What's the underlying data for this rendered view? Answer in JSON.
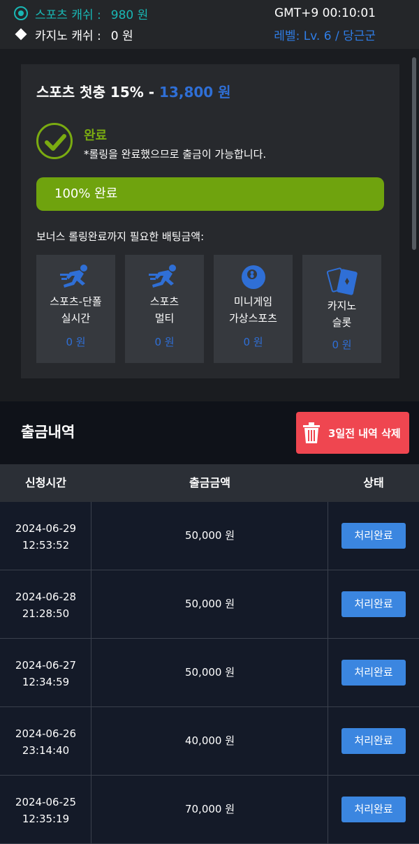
{
  "topbar": {
    "sports_cash_label": "스포츠 캐쉬 :",
    "sports_cash_value": "980 원",
    "casino_cash_label": "카지노 캐쉬 :",
    "casino_cash_value": "0 원",
    "clock": "GMT+9 00:10:01",
    "level": "레벨: Lv. 6 / 당근군"
  },
  "bonus_card": {
    "title": "스포츠 첫충 15% -",
    "amount": "13,800 원",
    "done_label": "완료",
    "done_note": "*롤링을 완료했으므로 출금이 가능합니다.",
    "progress_percent": 100,
    "progress_label": "100% 완료",
    "required_label": "보너스 롤링완료까지 필요한 배팅금액:",
    "tiles": [
      {
        "icon": "runner-icon",
        "line1": "스포츠-단폴",
        "line2": "실시간",
        "value": "0 원"
      },
      {
        "icon": "runner-icon",
        "line1": "스포츠",
        "line2": "멀티",
        "value": "0 원"
      },
      {
        "icon": "ball-8-icon",
        "line1": "미니게임",
        "line2": "가상스포츠",
        "value": "0 원"
      },
      {
        "icon": "cards-icon",
        "line1": "카지노",
        "line2": "슬롯",
        "value": "0 원"
      }
    ]
  },
  "withdrawals": {
    "title": "출금내역",
    "delete_button": "3일전 내역 삭제",
    "columns": [
      "신청시간",
      "출금금액",
      "상태"
    ],
    "rows": [
      {
        "date": "2024-06-29",
        "time": "12:53:52",
        "amount": "50,000 원",
        "status": "처리완료"
      },
      {
        "date": "2024-06-28",
        "time": "21:28:50",
        "amount": "50,000 원",
        "status": "처리완료"
      },
      {
        "date": "2024-06-27",
        "time": "12:34:59",
        "amount": "50,000 원",
        "status": "처리완료"
      },
      {
        "date": "2024-06-26",
        "time": "23:14:40",
        "amount": "40,000 원",
        "status": "처리완료"
      },
      {
        "date": "2024-06-25",
        "time": "12:35:19",
        "amount": "70,000 원",
        "status": "처리완료"
      }
    ]
  },
  "colors": {
    "accent_teal": "#19b7b4",
    "accent_blue": "#2f6fd6",
    "success_green": "#6fa30e",
    "danger_red": "#ef4650",
    "button_blue": "#3b86e0"
  }
}
